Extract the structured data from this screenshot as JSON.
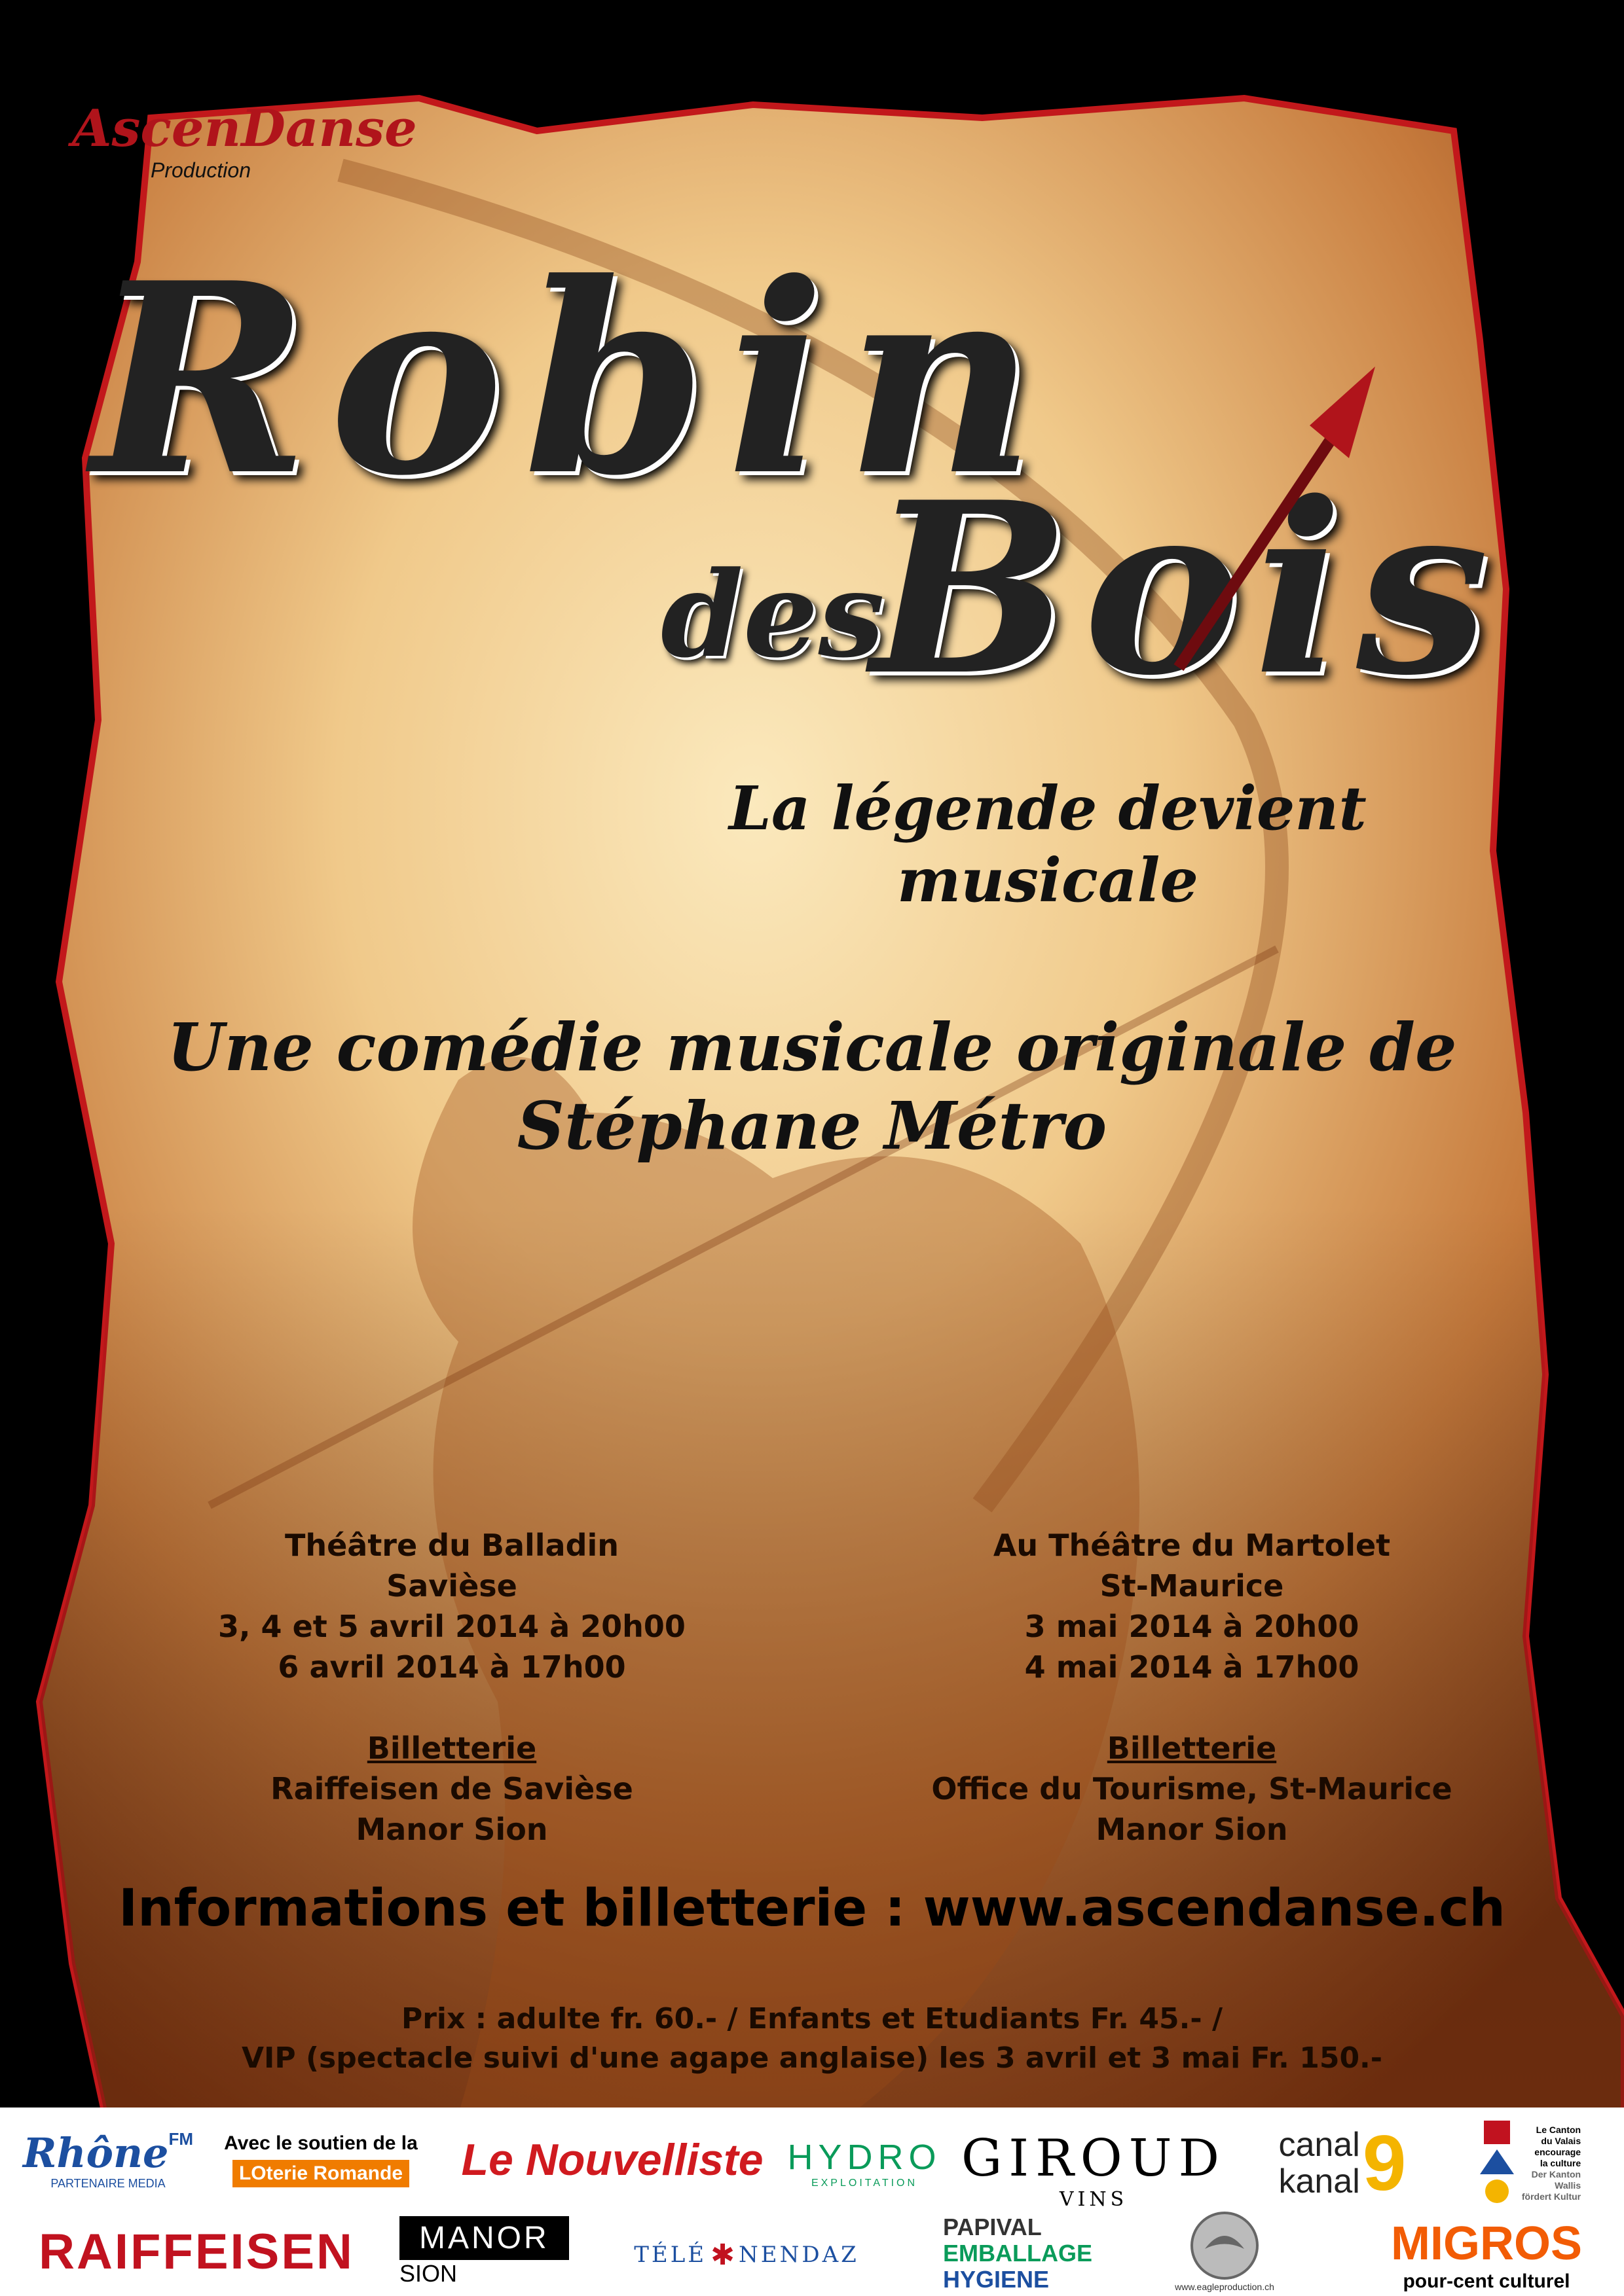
{
  "brand": {
    "name": "AscenDanse",
    "sub": "Production"
  },
  "title": {
    "line1": "Robin",
    "line2a": "des",
    "line2b": "Bois",
    "tagline": "La légende devient musicale"
  },
  "credit": {
    "line1": "Une comédie musicale originale de",
    "line2": "Stéphane Métro"
  },
  "venue_left": {
    "name": "Théâtre du Balladin",
    "city": "Savièse",
    "date1": "3, 4 et 5 avril 2014 à 20h00",
    "date2": "6 avril 2014 à 17h00",
    "ticket_title": "Billetterie",
    "ticket1": "Raiffeisen de Savièse",
    "ticket2": "Manor Sion"
  },
  "venue_right": {
    "name": "Au Théâtre du Martolet",
    "city": "St-Maurice",
    "date1": "3 mai 2014 à 20h00",
    "date2": "4 mai 2014 à 17h00",
    "ticket_title": "Billetterie",
    "ticket1": "Office du Tourisme, St-Maurice",
    "ticket2": "Manor Sion"
  },
  "info_line": "Informations et billetterie : www.ascendanse.ch",
  "prices": {
    "line1": "Prix : adulte fr. 60.- / Enfants et Etudiants Fr. 45.- /",
    "line2": "VIP (spectacle suivi d'une agape anglaise) les 3 avril et 3 mai Fr. 150.-"
  },
  "sponsors": {
    "rhone": "Rhône",
    "rhone_fm": "FM",
    "rhone_sub": "PARTENAIRE MEDIA",
    "support": "Avec le soutien de la",
    "loterie": "LOterie Romande",
    "nouvelliste": "Le Nouvelliste",
    "hydro": "HYDRO",
    "hydro_sub": "EXPLOITATION",
    "giroud": "GIROUD",
    "giroud_sub": "VINS",
    "canal1": "canal",
    "canal2": "kanal",
    "canal_num": "9",
    "canton1": "Le Canton",
    "canton2": "du Valais",
    "canton3": "encourage",
    "canton4": "la culture",
    "canton5": "Der Kanton",
    "canton6": "Wallis",
    "canton7": "fördert Kultur",
    "raiffeisen": "RAIFFEISEN",
    "manor": "MANOR",
    "manor_sub": "SION",
    "tele": "TÉLÉ",
    "nendaz": "NENDAZ",
    "papival1": "PAPIVAL",
    "papival2": "EMBALLAGE",
    "papival3": "HYGIENE",
    "eagle_url": "www.eagleproduction.ch",
    "migros": "MIGROS",
    "migros_sub": "pour-cent culturel"
  },
  "colors": {
    "parchment_light": "#f7dfa6",
    "parchment_dark": "#8a4416",
    "edge": "#c2181b",
    "migros": "#f25c05",
    "raiffeisen": "#c1121f"
  }
}
